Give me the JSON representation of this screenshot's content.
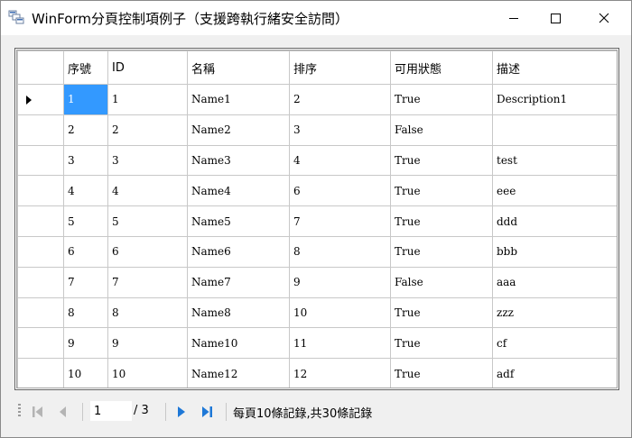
{
  "window": {
    "title": "WinForm分頁控制項例子（支援跨執行緒安全訪問）"
  },
  "grid": {
    "columns": [
      "序號",
      "ID",
      "名稱",
      "排序",
      "可用狀態",
      "描述"
    ],
    "rows": [
      [
        "1",
        "1",
        "Name1",
        "2",
        "True",
        "Description1"
      ],
      [
        "2",
        "2",
        "Name2",
        "3",
        "False",
        ""
      ],
      [
        "3",
        "3",
        "Name3",
        "4",
        "True",
        "test"
      ],
      [
        "4",
        "4",
        "Name4",
        "6",
        "True",
        "eee"
      ],
      [
        "5",
        "5",
        "Name5",
        "7",
        "True",
        "ddd"
      ],
      [
        "6",
        "6",
        "Name6",
        "8",
        "True",
        "bbb"
      ],
      [
        "7",
        "7",
        "Name7",
        "9",
        "False",
        "aaa"
      ],
      [
        "8",
        "8",
        "Name8",
        "10",
        "True",
        "zzz"
      ],
      [
        "9",
        "9",
        "Name10",
        "11",
        "True",
        "cf"
      ],
      [
        "10",
        "10",
        "Name12",
        "12",
        "True",
        "adf"
      ]
    ],
    "selected_row": 0,
    "selected_col": 0
  },
  "pager": {
    "current_page": "1",
    "total_pages_text": "/ 3",
    "records_text": "每頁10條記錄,共30條記錄"
  },
  "colors": {
    "selection": "#3399ff",
    "nav_active": "#1e78d7",
    "nav_disabled": "#b4b4b4"
  },
  "icons": [
    "app-icon",
    "minimize-icon",
    "maximize-icon",
    "close-icon",
    "first-page-icon",
    "prev-page-icon",
    "next-page-icon",
    "last-page-icon"
  ]
}
